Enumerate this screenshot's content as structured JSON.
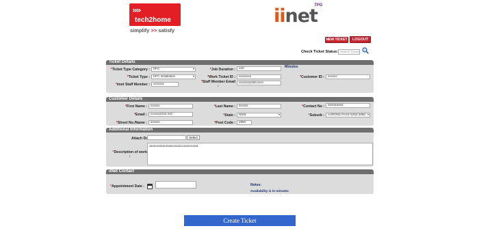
{
  "logos": {
    "tech2home": {
      "arrows": "»»",
      "brand": "tech2home",
      "tagline_left": "simplify",
      "tagline_chevrons": ">>",
      "tagline_right": "satisfy"
    },
    "iinet": {
      "word_i": "ii",
      "word_rest": "net",
      "tpg": "TPG"
    }
  },
  "actions": {
    "new_ticket": "NEW TICKET",
    "logout": "LOGOUT"
  },
  "check_status": {
    "label": "Check Ticket Status:",
    "placeholder": "Search Ticket"
  },
  "ticket_details": {
    "title": "Ticket Details",
    "ticket_type_category_label": "Ticket Type Category :",
    "ticket_type_category_value": "HFC",
    "job_duration_label": "Job Duration :",
    "job_duration_value": "120",
    "job_duration_unit": "Minutes",
    "ticket_type_label": "Ticket Type :",
    "ticket_type_value": "HFC Installation",
    "work_ticket_id_label": "Work Ticket ID :",
    "work_ticket_id_value": "xxxxxxxx",
    "customer_id_label": "Customer ID :",
    "customer_id_value": "xxxxxx",
    "iinet_staff_member_label": "iinet Staff Member :",
    "iinet_staff_member_value": "xxxxxxx",
    "staff_member_email_label": "Staff Member Email",
    "staff_member_email_colon": ":",
    "staff_member_email_value": "xxxxxx@ddd.xxxx"
  },
  "customer_details": {
    "title": "Customer Details",
    "first_name_label": "First Name :",
    "first_name_value": "xxxxxx",
    "last_name_label": "Last Name :",
    "last_name_value": "ssssss",
    "contact_no_label": "Contact No :",
    "contact_no_value": "333333333",
    "email_label": "Email :",
    "email_value": "xxxxx@222.222",
    "state_label": "State :",
    "state_value": "NSW",
    "suburb_label": "Suburb :",
    "suburb_value": "AARONS PASS NSW 2850",
    "street_label": "Street No./Name :",
    "street_value": "ssssss",
    "post_code_label": "Post Code :",
    "post_code_value": "2850"
  },
  "additional_information": {
    "title": "Additional Information",
    "attach_label": "Attach Documents :",
    "select_button": "Select",
    "description_label": "Description of work",
    "description_colon": ":",
    "description_value": "111111111111111111111111111111111"
  },
  "iinet_contact": {
    "title": "iiNet Contact",
    "appointment_date_label": "Appointment Date :",
    "notes_label": "Notes:",
    "availability_note": "Availability is in minutes"
  },
  "create_button": "Create Ticket",
  "colors": {
    "accent_red": "#c8252f",
    "section_header": "#6e6e6e",
    "create_blue": "#3366cc"
  }
}
